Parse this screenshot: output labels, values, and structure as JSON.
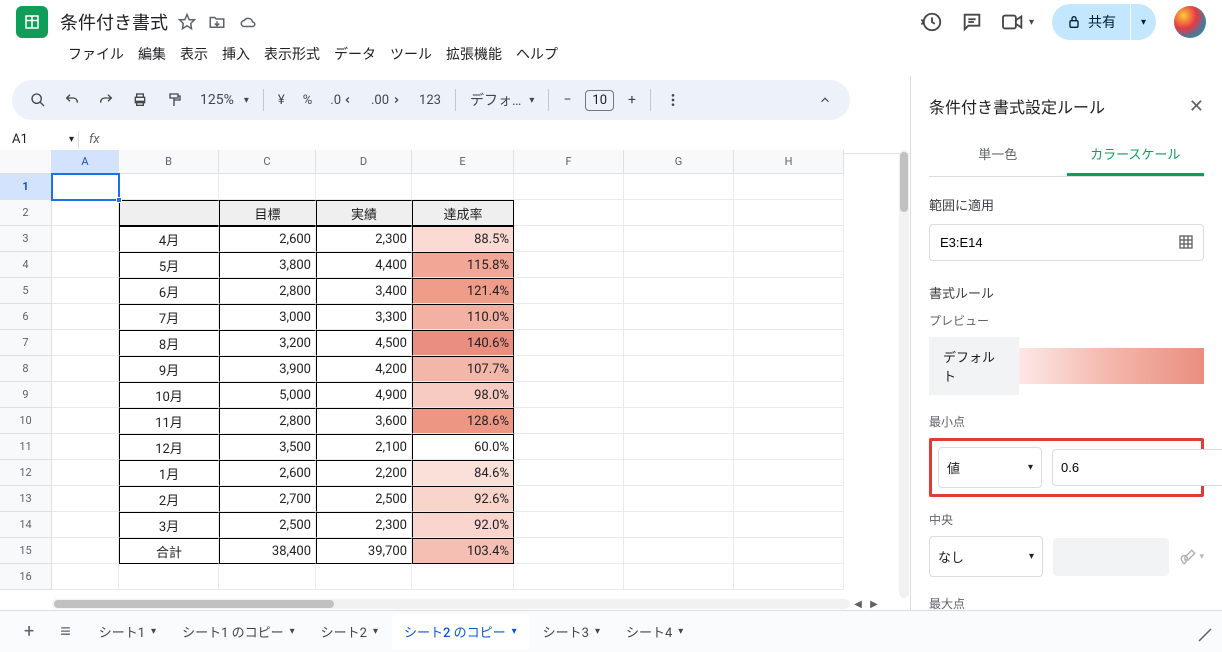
{
  "title": "条件付き書式",
  "menus": [
    "ファイル",
    "編集",
    "表示",
    "挿入",
    "表示形式",
    "データ",
    "ツール",
    "拡張機能",
    "ヘルプ"
  ],
  "toolbar": {
    "zoom": "125%",
    "currency": "¥",
    "percent": "%",
    "dec_dec": ".0",
    "inc_dec": ".00",
    "num123": "123",
    "font": "デフォ…",
    "minus": "−",
    "fontsize": "10",
    "plus": "+"
  },
  "namebox": "A1",
  "fx_label": "fx",
  "share": "共有",
  "colWidths": {
    "A": 67,
    "B": 100,
    "C": 97,
    "D": 96,
    "E": 102,
    "F": 110,
    "G": 110,
    "H": 110
  },
  "columns": [
    "A",
    "B",
    "C",
    "D",
    "E",
    "F",
    "G",
    "H"
  ],
  "rowNums": [
    1,
    2,
    3,
    4,
    5,
    6,
    7,
    8,
    9,
    10,
    11,
    12,
    13,
    14,
    15,
    16
  ],
  "table": {
    "headers": [
      "",
      "目標",
      "実績",
      "達成率"
    ],
    "rows": [
      {
        "label": "4月",
        "target": "2,600",
        "actual": "2,300",
        "rate": "88.5%",
        "color": "#fadad3"
      },
      {
        "label": "5月",
        "target": "3,800",
        "actual": "4,400",
        "rate": "115.8%",
        "color": "#f1a696"
      },
      {
        "label": "6月",
        "target": "2,800",
        "actual": "3,400",
        "rate": "121.4%",
        "color": "#ef9c8a"
      },
      {
        "label": "7月",
        "target": "3,000",
        "actual": "3,300",
        "rate": "110.0%",
        "color": "#f2b1a2"
      },
      {
        "label": "8月",
        "target": "3,200",
        "actual": "4,500",
        "rate": "140.6%",
        "color": "#ea8e7f"
      },
      {
        "label": "9月",
        "target": "3,900",
        "actual": "4,200",
        "rate": "107.7%",
        "color": "#f3b7a9"
      },
      {
        "label": "10月",
        "target": "5,000",
        "actual": "4,900",
        "rate": "98.0%",
        "color": "#f7cbc1"
      },
      {
        "label": "11月",
        "target": "2,800",
        "actual": "3,600",
        "rate": "128.6%",
        "color": "#ee9684"
      },
      {
        "label": "12月",
        "target": "3,500",
        "actual": "2,100",
        "rate": "60.0%",
        "color": "#ffffff"
      },
      {
        "label": "1月",
        "target": "2,600",
        "actual": "2,200",
        "rate": "84.6%",
        "color": "#fbe0da"
      },
      {
        "label": "2月",
        "target": "2,700",
        "actual": "2,500",
        "rate": "92.6%",
        "color": "#f9d4cb"
      },
      {
        "label": "3月",
        "target": "2,500",
        "actual": "2,300",
        "rate": "92.0%",
        "color": "#f9d5cd"
      },
      {
        "label": "合計",
        "target": "38,400",
        "actual": "39,700",
        "rate": "103.4%",
        "color": "#f5bfb3"
      }
    ]
  },
  "side": {
    "title": "条件付き書式設定ルール",
    "tab_single": "単一色",
    "tab_scale": "カラースケール",
    "apply_label": "範囲に適用",
    "range": "E3:E14",
    "rule_label": "書式ルール",
    "preview_label": "プレビュー",
    "default_label": "デフォルト",
    "min_label": "最小点",
    "min_type": "値",
    "min_value": "0.6",
    "mid_label": "中央",
    "mid_type": "なし",
    "max_label": "最大点"
  },
  "sheets": {
    "items": [
      "シート1",
      "シート1 のコピー",
      "シート2",
      "シート2 のコピー",
      "シート3",
      "シート4"
    ],
    "active": 3
  }
}
